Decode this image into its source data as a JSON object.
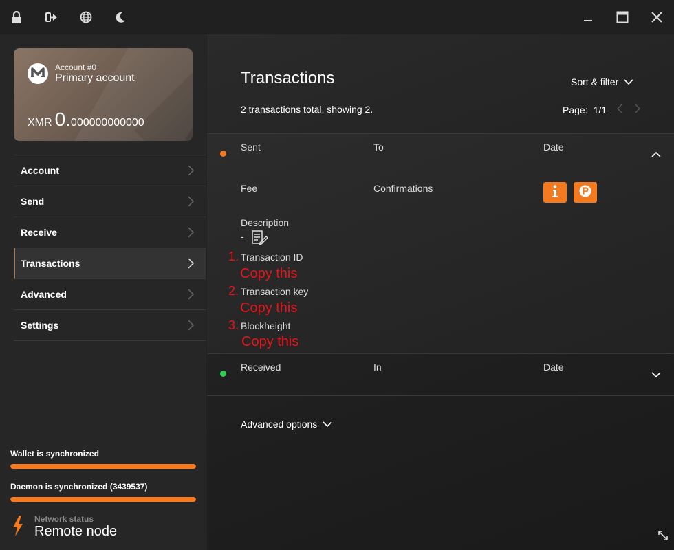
{
  "titlebar": {
    "icons": [
      "lock-icon",
      "logout-icon",
      "globe-icon",
      "moon-icon"
    ],
    "window_buttons": [
      "minimize-icon",
      "maximize-icon",
      "close-icon"
    ]
  },
  "account_card": {
    "account_number": "Account #0",
    "account_name": "Primary account",
    "currency": "XMR",
    "balance_int": "0.",
    "balance_dec": "000000000000"
  },
  "sidebar": {
    "items": [
      {
        "label": "Account"
      },
      {
        "label": "Send"
      },
      {
        "label": "Receive"
      },
      {
        "label": "Transactions",
        "active": true
      },
      {
        "label": "Advanced"
      },
      {
        "label": "Settings"
      }
    ],
    "wallet_sync": {
      "label": "Wallet is synchronized",
      "progress": 1.0
    },
    "daemon_sync": {
      "label": "Daemon is synchronized (3439537)",
      "progress": 1.0
    },
    "network_status": {
      "label": "Network status",
      "value": "Remote node"
    }
  },
  "main": {
    "title": "Transactions",
    "sort_filter": "Sort & filter",
    "summary": "2 transactions total, showing 2.",
    "page_label": "Page:",
    "page_value": "1/1",
    "transactions": [
      {
        "status_color": "#f47a1f",
        "col1": "Sent",
        "col2": "To",
        "col3": "Date",
        "fee_label": "Fee",
        "confirmations_label": "Confirmations",
        "description_label": "Description",
        "description_value": "-",
        "details": [
          {
            "number": "1.",
            "label": "Transaction ID",
            "annotation": "Copy this"
          },
          {
            "number": "2.",
            "label": "Transaction key",
            "annotation": "Copy this"
          },
          {
            "number": "3.",
            "label": "Blockheight",
            "annotation": "Copy this"
          }
        ],
        "badges": [
          "info-icon",
          "proof-icon"
        ]
      },
      {
        "status_color": "#2ecc55",
        "col1": "Received",
        "col2": "In",
        "col3": "Date"
      }
    ],
    "advanced_options": "Advanced options"
  },
  "colors": {
    "accent": "#f47a1f",
    "annotation": "#e8141a",
    "received": "#2ecc55"
  }
}
